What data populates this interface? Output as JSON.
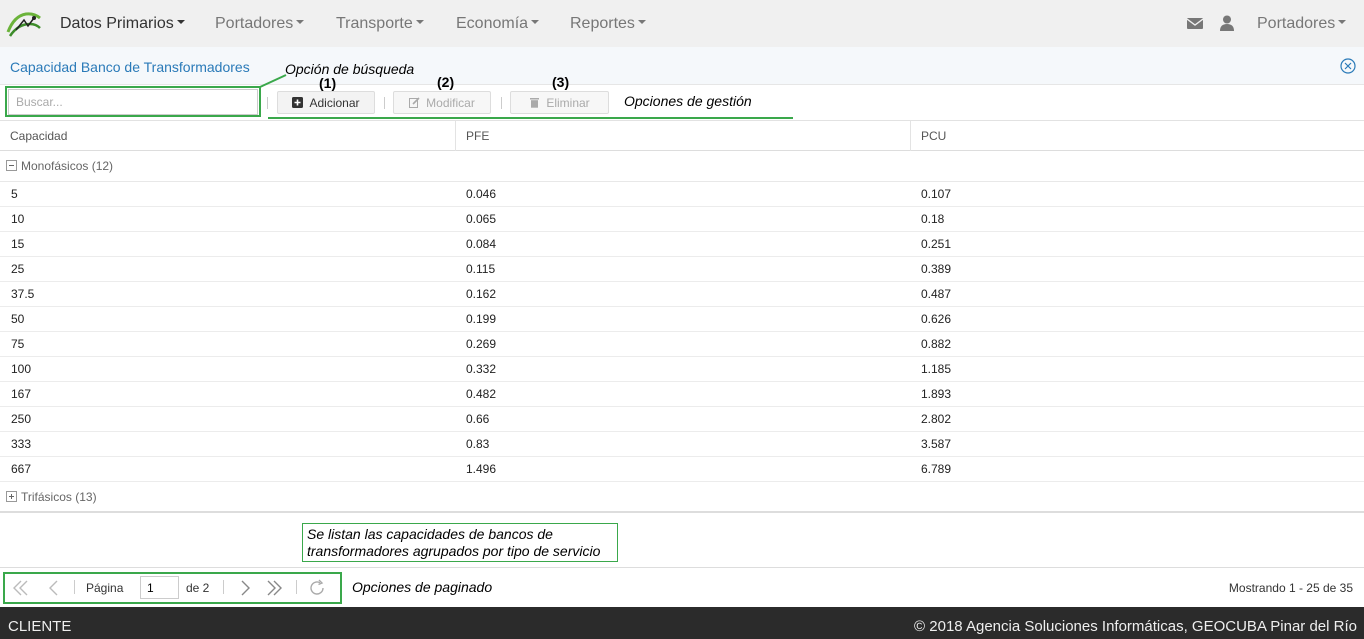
{
  "nav": {
    "items": [
      {
        "label": "Datos Primarios"
      },
      {
        "label": "Portadores"
      },
      {
        "label": "Transporte"
      },
      {
        "label": "Economía"
      },
      {
        "label": "Reportes"
      }
    ],
    "user_menu": "Portadores"
  },
  "panel": {
    "title": "Capacidad Banco de Transformadores"
  },
  "toolbar": {
    "search_placeholder": "Buscar...",
    "add_label": "Adicionar",
    "edit_label": "Modificar",
    "delete_label": "Eliminar"
  },
  "annotations": {
    "search": "Opción de búsqueda",
    "num1": "(1)",
    "num2": "(2)",
    "num3": "(3)",
    "management": "Opciones de gestión",
    "list_note": "Se listan las capacidades de bancos de transformadores agrupados por tipo de servicio",
    "paging": "Opciones de paginado"
  },
  "grid": {
    "columns": [
      "Capacidad",
      "PFE",
      "PCU"
    ],
    "group1": "Monofásicos (12)",
    "group2": "Trifásicos (13)",
    "rows": [
      [
        "5",
        "0.046",
        "0.107"
      ],
      [
        "10",
        "0.065",
        "0.18"
      ],
      [
        "15",
        "0.084",
        "0.251"
      ],
      [
        "25",
        "0.115",
        "0.389"
      ],
      [
        "37.5",
        "0.162",
        "0.487"
      ],
      [
        "50",
        "0.199",
        "0.626"
      ],
      [
        "75",
        "0.269",
        "0.882"
      ],
      [
        "100",
        "0.332",
        "1.185"
      ],
      [
        "167",
        "0.482",
        "1.893"
      ],
      [
        "250",
        "0.66",
        "2.802"
      ],
      [
        "333",
        "0.83",
        "3.587"
      ],
      [
        "667",
        "1.496",
        "6.789"
      ]
    ]
  },
  "pager": {
    "page_label": "Página",
    "page_value": "1",
    "of_label": "de 2",
    "showing": "Mostrando 1 - 25 de 35"
  },
  "footer": {
    "left": "CLIENTE",
    "right": "© 2018 Agencia Soluciones Informáticas, GEOCUBA Pinar del Río"
  },
  "colors": {
    "accent": "#2a7ab8",
    "annotation_green": "#3aa84b",
    "footer_bg": "#2b2b2b"
  }
}
